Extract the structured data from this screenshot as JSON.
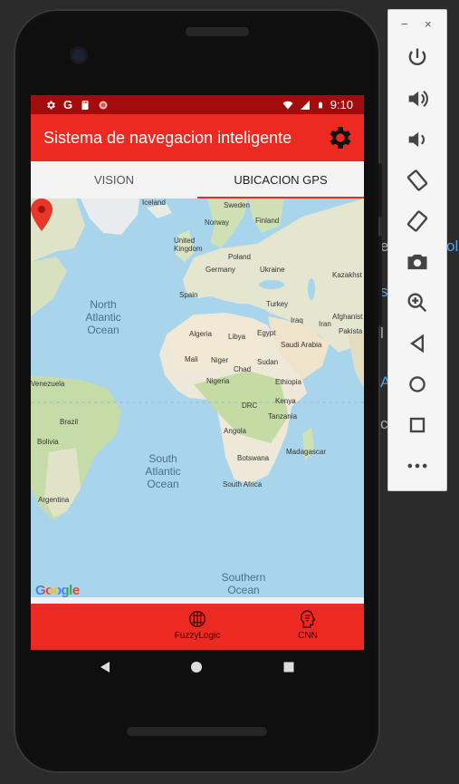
{
  "app": {
    "title": "Sistema de navegacion inteligente",
    "settings_icon": "gear-icon"
  },
  "status_bar": {
    "time": "9:10",
    "left_icons": [
      "gear-icon",
      "google-icon",
      "sd-card-icon",
      "record-icon"
    ],
    "right_icons": [
      "wifi-icon",
      "signal-icon",
      "battery-icon"
    ]
  },
  "tabs": [
    {
      "label": "VISION",
      "active": false
    },
    {
      "label": "UBICACION GPS",
      "active": true
    }
  ],
  "map": {
    "attribution": "Google",
    "oceans": [
      "North Atlantic Ocean",
      "South Atlantic Ocean",
      "Southern Ocean"
    ],
    "ocean_lines": {
      "north": [
        "North",
        "Atlantic",
        "Ocean"
      ],
      "south": [
        "South",
        "Atlantic",
        "Ocean"
      ],
      "southern": [
        "Southern",
        "Ocean"
      ]
    },
    "labels": {
      "iceland": "Iceland",
      "sweden": "Sweden",
      "norway": "Norway",
      "finland": "Finland",
      "uk": "United Kingdom",
      "poland": "Poland",
      "germany": "Germany",
      "ukraine": "Ukraine",
      "kazakhstan": "Kazakhst",
      "spain": "Spain",
      "turkey": "Turkey",
      "iraq": "Iraq",
      "iran": "Iran",
      "afghanistan": "Afghanist",
      "pakistan": "Pakista",
      "algeria": "Algeria",
      "libya": "Libya",
      "egypt": "Egypt",
      "saudi": "Saudi Arabia",
      "mali": "Mali",
      "niger": "Niger",
      "chad": "Chad",
      "sudan": "Sudan",
      "ethiopia": "Ethiopia",
      "nigeria": "Nigeria",
      "venezuela": "Venezuela",
      "drc": "DRC",
      "kenya": "Kenya",
      "tanzania": "Tanzania",
      "brazil": "Brazil",
      "angola": "Angola",
      "bolivia": "Bolivia",
      "madagascar": "Madagascar",
      "botswana": "Botswana",
      "south_africa": "South Africa",
      "argentina": "Argentina"
    }
  },
  "bottom_nav": [
    {
      "label": "FuzzyLogic",
      "icon": "brain-circuit-icon"
    },
    {
      "label": "CNN",
      "icon": "head-brain-icon"
    }
  ],
  "system_nav": [
    "back-icon",
    "home-icon",
    "recents-icon"
  ],
  "emulator_toolbar": {
    "minimize": "−",
    "close": "×",
    "buttons": [
      "power-icon",
      "volume-up-icon",
      "volume-down-icon",
      "rotate-left-icon",
      "rotate-right-icon",
      "camera-icon",
      "zoom-icon",
      "back-icon",
      "home-icon",
      "overview-icon",
      "more-icon"
    ]
  },
  "colors": {
    "accent": "#ec2a22",
    "status_bar": "#a30c0c",
    "ocean": "#a8d5ec",
    "land": "#e8e4d8",
    "vegetation": "#c8deb0"
  }
}
